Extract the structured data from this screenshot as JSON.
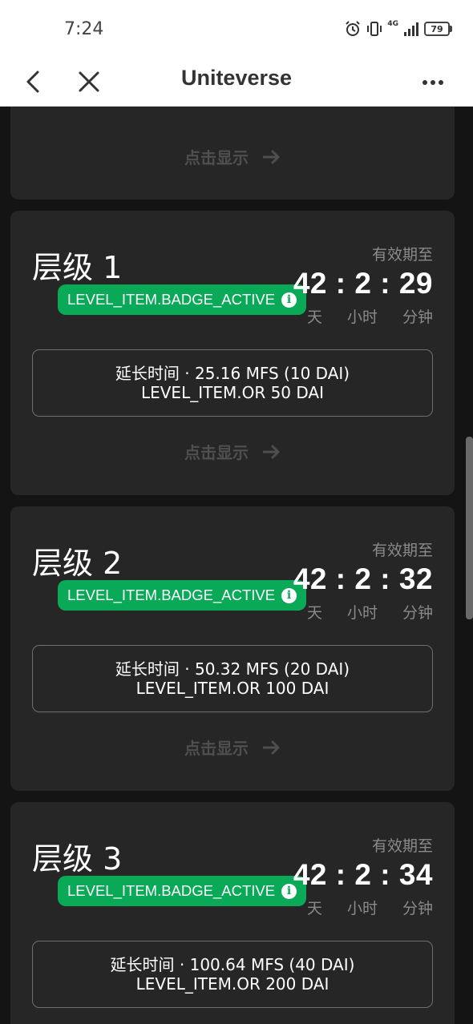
{
  "status_bar": {
    "time": "7:24",
    "network": "4G",
    "battery": "79"
  },
  "app_bar": {
    "title": "Uniteverse"
  },
  "top_card": {
    "reveal_label": "点击显示"
  },
  "levels": [
    {
      "title": "层级 1",
      "badge": "LEVEL_ITEM.BADGE_ACTIVE",
      "valid_until_label": "有效期至",
      "countdown": "42 : 2 : 29",
      "unit_day": "天",
      "unit_hour": "小时",
      "unit_minute": "分钟",
      "extend_line1": "延长时间 · 25.16 MFS (10 DAI)",
      "extend_line2": "LEVEL_ITEM.OR 50 DAI",
      "reveal_label": "点击显示"
    },
    {
      "title": "层级 2",
      "badge": "LEVEL_ITEM.BADGE_ACTIVE",
      "valid_until_label": "有效期至",
      "countdown": "42 : 2 : 32",
      "unit_day": "天",
      "unit_hour": "小时",
      "unit_minute": "分钟",
      "extend_line1": "延长时间 · 50.32 MFS (20 DAI)",
      "extend_line2": "LEVEL_ITEM.OR 100 DAI",
      "reveal_label": "点击显示"
    },
    {
      "title": "层级 3",
      "badge": "LEVEL_ITEM.BADGE_ACTIVE",
      "valid_until_label": "有效期至",
      "countdown": "42 : 2 : 34",
      "unit_day": "天",
      "unit_hour": "小时",
      "unit_minute": "分钟",
      "extend_line1": "延长时间 · 100.64 MFS (40 DAI)",
      "extend_line2": "LEVEL_ITEM.OR 200 DAI"
    }
  ],
  "colors": {
    "badge_green": "#09a957",
    "card_bg": "#262626",
    "page_bg": "#141414"
  }
}
